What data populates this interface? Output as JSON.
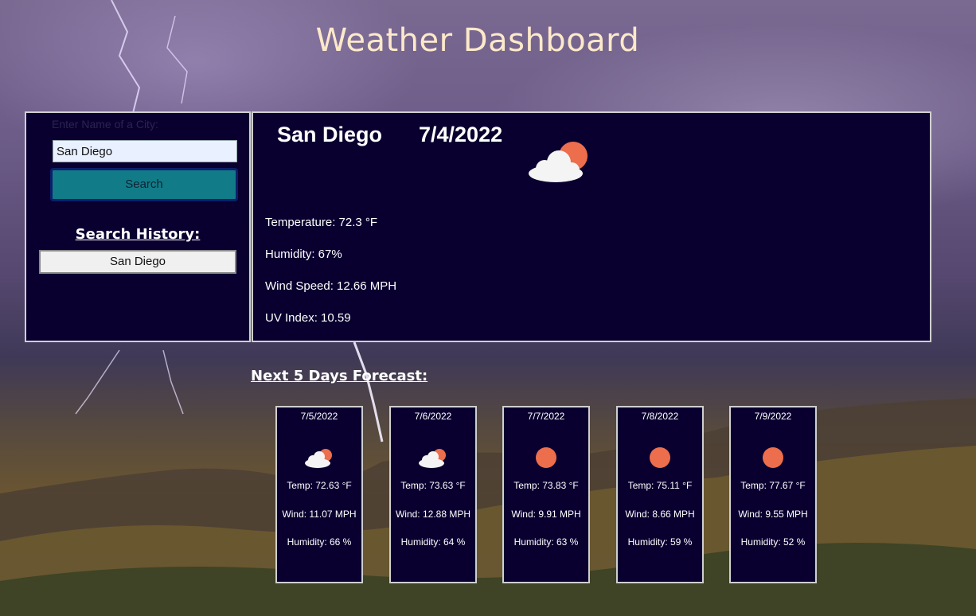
{
  "header": {
    "title": "Weather Dashboard"
  },
  "search": {
    "label": "Enter Name of a City:",
    "input_value": "San Diego",
    "button_label": "Search",
    "history_title": "Search History:",
    "history": [
      "San Diego"
    ]
  },
  "current": {
    "city": "San Diego",
    "date": "7/4/2022",
    "icon": "partly-cloudy-icon",
    "temperature": "Temperature: 72.3 °F",
    "humidity": "Humidity: 67%",
    "wind": "Wind Speed: 12.66 MPH",
    "uv": "UV Index:  10.59"
  },
  "forecast": {
    "title": "Next 5 Days Forecast:",
    "days": [
      {
        "date": "7/5/2022",
        "icon": "partly-cloudy-icon",
        "temp": "Temp: 72.63 °F",
        "wind": "Wind: 11.07 MPH",
        "humidity": "Humidity: 66 %"
      },
      {
        "date": "7/6/2022",
        "icon": "partly-cloudy-icon",
        "temp": "Temp: 73.63 °F",
        "wind": "Wind: 12.88 MPH",
        "humidity": "Humidity: 64 %"
      },
      {
        "date": "7/7/2022",
        "icon": "sun-icon",
        "temp": "Temp: 73.83 °F",
        "wind": "Wind: 9.91 MPH",
        "humidity": "Humidity: 63 %"
      },
      {
        "date": "7/8/2022",
        "icon": "sun-icon",
        "temp": "Temp: 75.11 °F",
        "wind": "Wind: 8.66 MPH",
        "humidity": "Humidity: 59 %"
      },
      {
        "date": "7/9/2022",
        "icon": "sun-icon",
        "temp": "Temp: 77.67 °F",
        "wind": "Wind: 9.55 MPH",
        "humidity": "Humidity: 52 %"
      }
    ]
  },
  "colors": {
    "panel_bg": "#0a0030",
    "title_color": "#fde9c9",
    "button_bg": "#117c88",
    "sun": "#ec6e4c"
  }
}
